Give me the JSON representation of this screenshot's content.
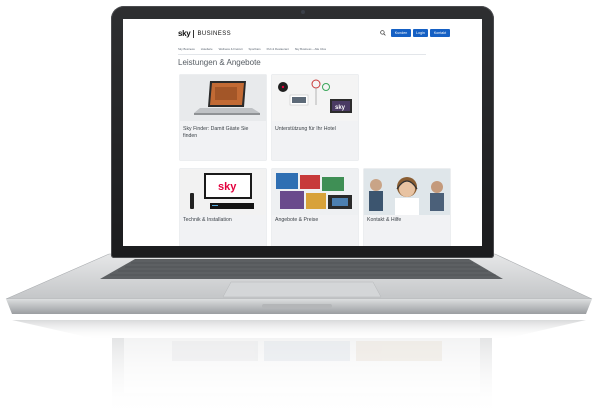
{
  "site": {
    "logo_sky": "sky",
    "logo_business": "BUSINESS",
    "buttons": [
      "Kunden",
      "Login",
      "Kontakt"
    ],
    "nav": [
      "Sky Business",
      "Hotellerie",
      "Wellness & Freizeit",
      "Sportbars",
      "Pub & Restaurant",
      "Sky Business – Alle Infos"
    ]
  },
  "page": {
    "title": "Leistungen & Angebote"
  },
  "tiles": [
    {
      "label": "Sky Finder: Damit Gäste Sie finden"
    },
    {
      "label": "Unterstützung für Ihr Hotel"
    },
    {
      "label": "Technik & Installation"
    },
    {
      "label": "Angebote & Preise"
    },
    {
      "label": "Kontakt & Hilfe"
    }
  ],
  "images": {
    "tv_logo": "sky",
    "tv_logo2": "sky",
    "reflection_logo": "sky"
  },
  "colors": {
    "accent_blue": "#1560c4",
    "sky_brand": "#e3003d",
    "bezel": "#1d1e20",
    "aluminium": "#c9cbcd"
  }
}
